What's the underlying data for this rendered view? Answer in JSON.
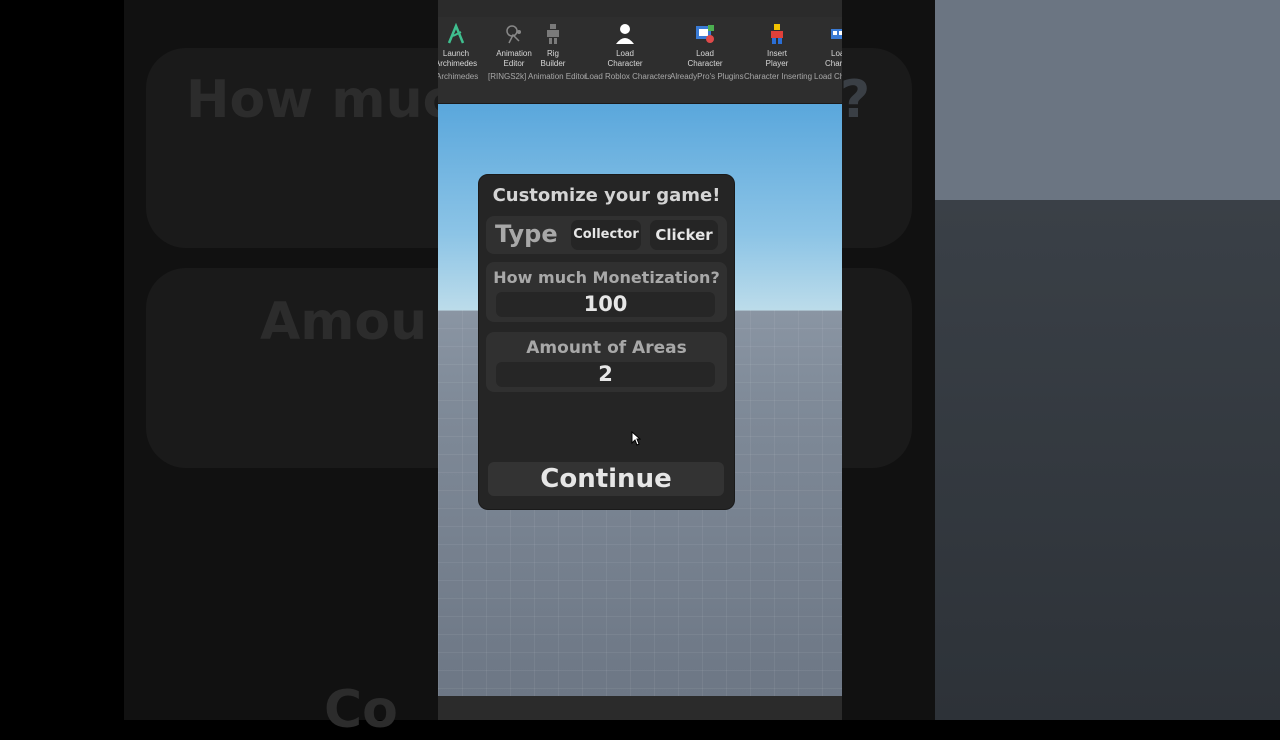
{
  "ribbon": {
    "items": [
      {
        "label_line1": "Launch",
        "label_line2": "Archimedes",
        "icon": "archimedes-icon"
      },
      {
        "label_line1": "Animation",
        "label_line2": "Editor",
        "icon": "animation-editor-icon"
      },
      {
        "label_line1": "Rig",
        "label_line2": "Builder",
        "icon": "rig-builder-icon"
      },
      {
        "label_line1": "Load",
        "label_line2": "Character",
        "icon": "person-icon"
      },
      {
        "label_line1": "Load",
        "label_line2": "Character",
        "icon": "load-character-icon"
      },
      {
        "label_line1": "Insert",
        "label_line2": "Player",
        "icon": "insert-player-icon"
      },
      {
        "label_line1": "Loa",
        "label_line2": "Chara",
        "icon": "load-character-icon"
      }
    ],
    "groups": [
      "Archimedes",
      "[RINGS2k] Animation Editor",
      "Load Roblox Characters",
      "AlreadyPro's Plugins",
      "Character Inserting",
      "Load Ch"
    ]
  },
  "dialog": {
    "title": "Customize your game!",
    "type_label": "Type",
    "type_options": [
      "Collector",
      "Clicker"
    ],
    "monetization_label": "How much Monetization?",
    "monetization_value": "100",
    "areas_label": "Amount of Areas",
    "areas_value": "2",
    "continue_label": "Continue"
  },
  "background": {
    "blur_text_1": "How much",
    "blur_text_2": "?",
    "blur_text_3": "Amou",
    "blur_text_4": "Co"
  }
}
